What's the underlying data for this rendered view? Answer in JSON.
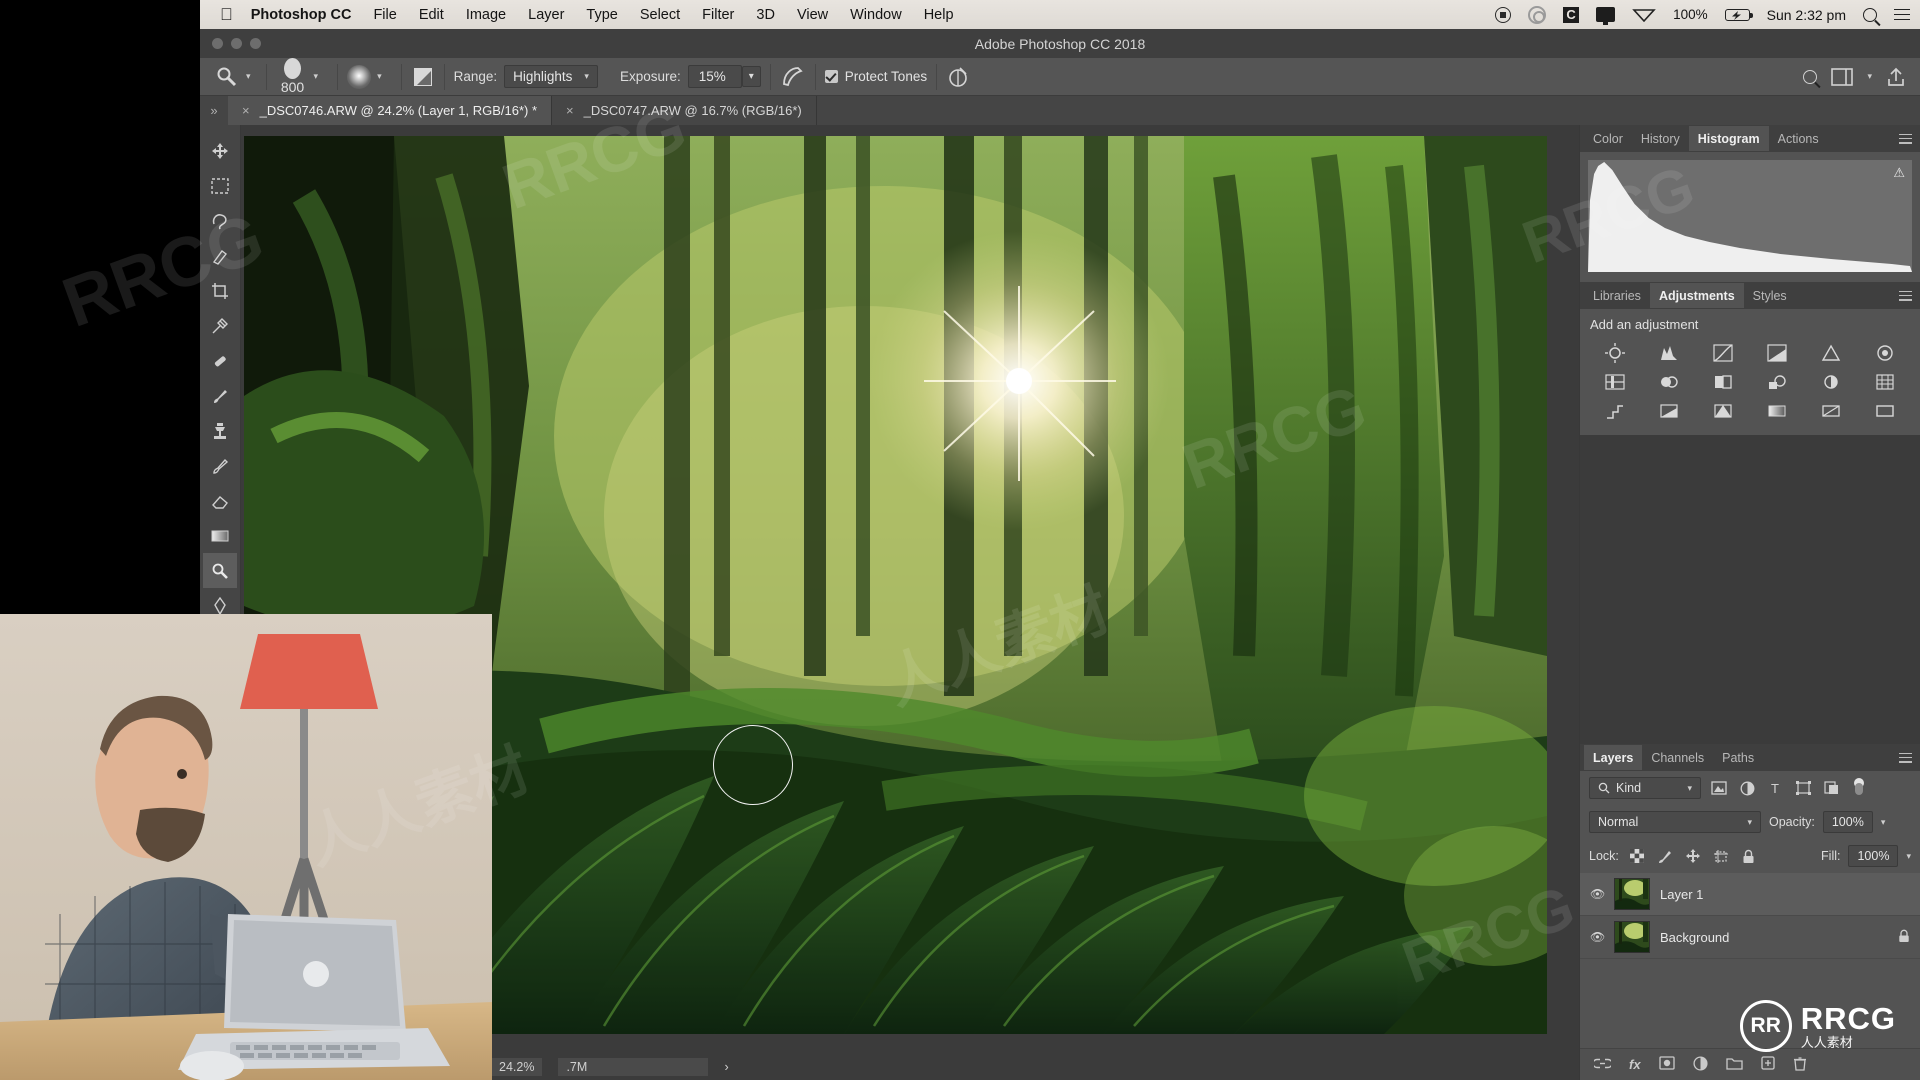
{
  "macos_menubar": {
    "apple_icon": "apple-icon",
    "app_name": "Photoshop CC",
    "menus": [
      "File",
      "Edit",
      "Image",
      "Layer",
      "Type",
      "Select",
      "Filter",
      "3D",
      "View",
      "Window",
      "Help"
    ],
    "status_icons": [
      "record-icon",
      "creative-cloud-icon",
      "c-icon",
      "display-icon",
      "wifi-icon"
    ],
    "battery_percent": "100%",
    "battery_icon": "battery-charging-icon",
    "time": "Sun 2:32 pm",
    "search_icon": "search-icon",
    "control_center_icon": "list-icon"
  },
  "window": {
    "title": "Adobe Photoshop CC 2018",
    "traffic_lights": [
      "close",
      "minimize",
      "zoom"
    ]
  },
  "options_bar": {
    "tool_icon": "dodge-tool-icon",
    "brush_size": "800",
    "brush_preset_icon": "brush-preview-icon",
    "airbrush_icon": "airbrush-toggle-icon",
    "range_label": "Range:",
    "range_value": "Highlights",
    "exposure_label": "Exposure:",
    "exposure_value": "15%",
    "pressure_icon": "tablet-pressure-icon",
    "protect_tones_label": "Protect Tones",
    "protect_tones_checked": true,
    "symmetry_icon": "symmetry-icon",
    "right_icons": [
      "search-icon",
      "workspace-icon",
      "share-icon"
    ]
  },
  "tabs": {
    "expand_icon": "chevron-double-right-icon",
    "items": [
      {
        "label": "_DSC0746.ARW @ 24.2% (Layer 1, RGB/16*) *",
        "active": true,
        "close_icon": "close-icon"
      },
      {
        "label": "_DSC0747.ARW @ 16.7% (RGB/16*)",
        "active": false,
        "close_icon": "close-icon"
      }
    ]
  },
  "toolbar": {
    "tools": [
      {
        "name": "move-tool",
        "glyph": "✛",
        "selected": false
      },
      {
        "name": "marquee-tool",
        "glyph": "▭",
        "selected": false
      },
      {
        "name": "lasso-tool",
        "glyph": "◠",
        "selected": false
      },
      {
        "name": "quick-selection-tool",
        "glyph": "✎",
        "selected": false
      },
      {
        "name": "crop-tool",
        "glyph": "⌗",
        "selected": false
      },
      {
        "name": "eyedropper-tool",
        "glyph": "⌇",
        "selected": false
      },
      {
        "name": "spot-healing-tool",
        "glyph": "✜",
        "selected": false
      },
      {
        "name": "brush-tool",
        "glyph": "✒",
        "selected": false
      },
      {
        "name": "clone-stamp-tool",
        "glyph": "⎔",
        "selected": false
      },
      {
        "name": "history-brush-tool",
        "glyph": "↻",
        "selected": false
      },
      {
        "name": "eraser-tool",
        "glyph": "◧",
        "selected": false
      },
      {
        "name": "gradient-tool",
        "glyph": "▬",
        "selected": false
      },
      {
        "name": "dodge-tool",
        "glyph": "☍",
        "selected": true
      },
      {
        "name": "pen-tool",
        "glyph": "✑",
        "selected": false
      }
    ]
  },
  "status_bar": {
    "zoom": "24.2%",
    "doc_size": ".7M",
    "arrow_icon": "chevron-right-icon"
  },
  "panels": {
    "top_group": {
      "tabs": [
        "Color",
        "History",
        "Histogram",
        "Actions"
      ],
      "active": "Histogram",
      "menu_icon": "panel-menu-icon",
      "histogram_warning_icon": "cached-data-warning-icon"
    },
    "adjustments_group": {
      "tabs": [
        "Libraries",
        "Adjustments",
        "Styles"
      ],
      "active": "Adjustments",
      "menu_icon": "panel-menu-icon",
      "heading": "Add an adjustment",
      "adjustment_icons": [
        "brightness-contrast-icon",
        "levels-icon",
        "curves-icon",
        "exposure-icon",
        "vibrance-icon",
        "hue-saturation-icon",
        "color-balance-icon",
        "black-white-icon",
        "photo-filter-icon",
        "channel-mixer-icon",
        "color-lookup-icon",
        "invert-icon",
        "posterize-icon",
        "threshold-icon",
        "selective-color-icon",
        "gradient-map-icon",
        "gradient-fill-icon",
        "solid-color-icon"
      ]
    },
    "layers_group": {
      "tabs": [
        "Layers",
        "Channels",
        "Paths"
      ],
      "active": "Layers",
      "menu_icon": "panel-menu-icon",
      "filter": {
        "search_icon": "search-icon",
        "kind_label": "Kind",
        "caret_icon": "chevron-down-icon",
        "filter_icons": [
          "pixel-filter-icon",
          "adjustment-filter-icon",
          "type-filter-icon",
          "shape-filter-icon",
          "smart-object-filter-icon"
        ],
        "toggle_icon": "filter-toggle-icon"
      },
      "blend_mode": "Normal",
      "opacity_label": "Opacity:",
      "opacity_value": "100%",
      "lock_label": "Lock:",
      "lock_icons": [
        "lock-transparent-icon",
        "lock-image-icon",
        "lock-position-icon",
        "lock-artboard-icon",
        "lock-all-icon"
      ],
      "fill_label": "Fill:",
      "fill_value": "100%",
      "layers": [
        {
          "name": "Layer 1",
          "visible": true,
          "selected": true,
          "locked": false,
          "eye_icon": "eye-icon",
          "thumb": "layer-thumbnail"
        },
        {
          "name": "Background",
          "visible": true,
          "selected": false,
          "locked": true,
          "eye_icon": "eye-icon",
          "thumb": "layer-thumbnail",
          "lock_icon": "lock-icon"
        }
      ],
      "bottom_icons": [
        "link-layers-icon",
        "layer-style-icon",
        "layer-mask-icon",
        "new-fill-adjustment-icon",
        "new-group-icon",
        "new-layer-icon",
        "delete-layer-icon"
      ],
      "fx_label": "fx"
    }
  },
  "webcam_overlay": {
    "name": "webcam-video-overlay"
  },
  "watermark": {
    "brand": "RRCG",
    "sub_cn": "人人素材",
    "logo_text": "RR"
  },
  "colors": {
    "panel_bg": "#535353",
    "panel_tab_bg": "#3f3f3f",
    "toolbar_bg": "#454545",
    "canvas_bg": "#3b3b3b",
    "menubar_bg": "#e8e4df",
    "accent_text": "#efefef"
  }
}
